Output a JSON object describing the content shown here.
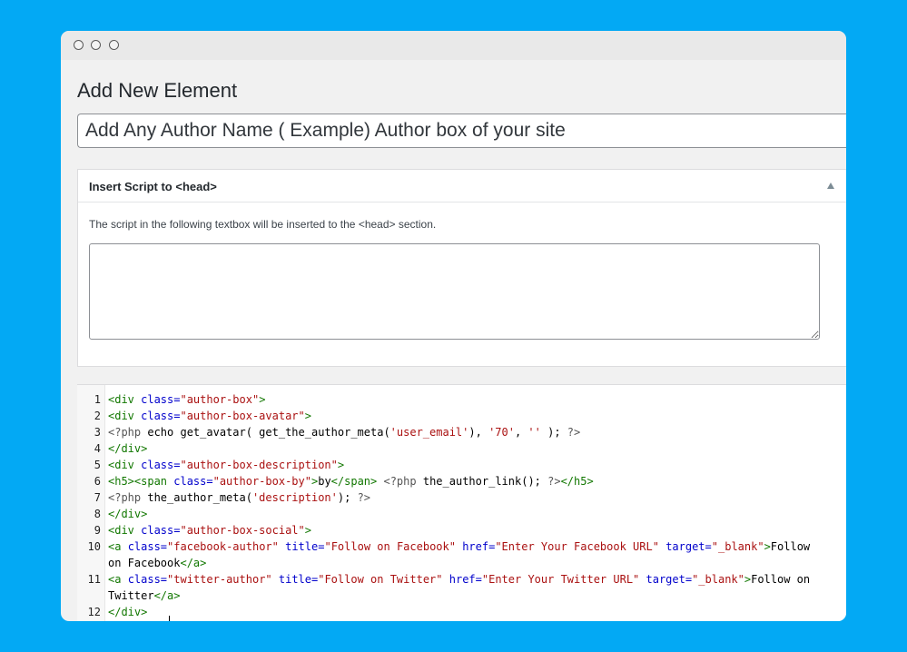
{
  "page": {
    "title": "Add New Element",
    "title_input_value": "Add Any Author Name ( Example) Author box of your site"
  },
  "colors": {
    "background": "#03a9f4",
    "window": "#f1f1f1",
    "titlebar": "#e9e9e9",
    "code_tag": "#117700",
    "code_attr": "#0000cc",
    "code_string": "#aa1111"
  },
  "window_controls": [
    "close-dot",
    "minimize-dot",
    "maximize-dot"
  ],
  "head_box": {
    "title": "Insert Script to <head>",
    "toggle_icon": "triangle-up-icon",
    "description": "The script in the following textbox will be inserted to the <head> section.",
    "textarea_value": ""
  },
  "code_editor": {
    "lines": [
      {
        "num": "1",
        "tokens": [
          {
            "t": "tag",
            "v": "<div "
          },
          {
            "t": "attr",
            "v": "class="
          },
          {
            "t": "str",
            "v": "\"author-box\""
          },
          {
            "t": "tag",
            "v": ">"
          }
        ]
      },
      {
        "num": "2",
        "tokens": [
          {
            "t": "tag",
            "v": "<div "
          },
          {
            "t": "attr",
            "v": "class="
          },
          {
            "t": "str",
            "v": "\"author-box-avatar\""
          },
          {
            "t": "tag",
            "v": ">"
          }
        ]
      },
      {
        "num": "3",
        "tokens": [
          {
            "t": "php",
            "v": "<?php "
          },
          {
            "t": "txt",
            "v": "echo get_avatar( get_the_author_meta("
          },
          {
            "t": "str",
            "v": "'user_email'"
          },
          {
            "t": "txt",
            "v": "), "
          },
          {
            "t": "str",
            "v": "'70'"
          },
          {
            "t": "txt",
            "v": ", "
          },
          {
            "t": "str",
            "v": "''"
          },
          {
            "t": "txt",
            "v": " ); "
          },
          {
            "t": "php",
            "v": "?>"
          }
        ]
      },
      {
        "num": "4",
        "tokens": [
          {
            "t": "tag",
            "v": "</div>"
          }
        ]
      },
      {
        "num": "5",
        "tokens": [
          {
            "t": "tag",
            "v": "<div "
          },
          {
            "t": "attr",
            "v": "class="
          },
          {
            "t": "str",
            "v": "\"author-box-description\""
          },
          {
            "t": "tag",
            "v": ">"
          }
        ]
      },
      {
        "num": "6",
        "tokens": [
          {
            "t": "tag",
            "v": "<h5><span "
          },
          {
            "t": "attr",
            "v": "class="
          },
          {
            "t": "str",
            "v": "\"author-box-by\""
          },
          {
            "t": "tag",
            "v": ">"
          },
          {
            "t": "txt",
            "v": "by"
          },
          {
            "t": "tag",
            "v": "</span>"
          },
          {
            "t": "txt",
            "v": " "
          },
          {
            "t": "php",
            "v": "<?php "
          },
          {
            "t": "txt",
            "v": "the_author_link(); "
          },
          {
            "t": "php",
            "v": "?>"
          },
          {
            "t": "tag",
            "v": "</h5>"
          }
        ]
      },
      {
        "num": "7",
        "tokens": [
          {
            "t": "php",
            "v": "<?php "
          },
          {
            "t": "txt",
            "v": "the_author_meta("
          },
          {
            "t": "str",
            "v": "'description'"
          },
          {
            "t": "txt",
            "v": "); "
          },
          {
            "t": "php",
            "v": "?>"
          }
        ]
      },
      {
        "num": "8",
        "tokens": [
          {
            "t": "tag",
            "v": "</div>"
          }
        ]
      },
      {
        "num": "9",
        "tokens": [
          {
            "t": "tag",
            "v": "<div "
          },
          {
            "t": "attr",
            "v": "class="
          },
          {
            "t": "str",
            "v": "\"author-box-social\""
          },
          {
            "t": "tag",
            "v": ">"
          }
        ]
      },
      {
        "num": "10",
        "tokens": [
          {
            "t": "tag",
            "v": "<a "
          },
          {
            "t": "attr",
            "v": "class="
          },
          {
            "t": "str",
            "v": "\"facebook-author\""
          },
          {
            "t": "txt",
            "v": " "
          },
          {
            "t": "attr",
            "v": "title="
          },
          {
            "t": "str",
            "v": "\"Follow on Facebook\""
          },
          {
            "t": "txt",
            "v": " "
          },
          {
            "t": "attr",
            "v": "href="
          },
          {
            "t": "str",
            "v": "\"Enter Your Facebook URL\""
          },
          {
            "t": "txt",
            "v": " "
          },
          {
            "t": "attr",
            "v": "target="
          },
          {
            "t": "str",
            "v": "\"_blank\""
          },
          {
            "t": "tag",
            "v": ">"
          },
          {
            "t": "txt",
            "v": "Follow on Facebook"
          },
          {
            "t": "tag",
            "v": "</a>"
          }
        ]
      },
      {
        "num": "11",
        "tokens": [
          {
            "t": "tag",
            "v": "<a "
          },
          {
            "t": "attr",
            "v": "class="
          },
          {
            "t": "str",
            "v": "\"twitter-author\""
          },
          {
            "t": "txt",
            "v": " "
          },
          {
            "t": "attr",
            "v": "title="
          },
          {
            "t": "str",
            "v": "\"Follow on Twitter\""
          },
          {
            "t": "txt",
            "v": " "
          },
          {
            "t": "attr",
            "v": "href="
          },
          {
            "t": "str",
            "v": "\"Enter Your Twitter URL\""
          },
          {
            "t": "txt",
            "v": " "
          },
          {
            "t": "attr",
            "v": "target="
          },
          {
            "t": "str",
            "v": "\"_blank\""
          },
          {
            "t": "tag",
            "v": ">"
          },
          {
            "t": "txt",
            "v": "Follow on Twitter"
          },
          {
            "t": "tag",
            "v": "</a>"
          }
        ]
      },
      {
        "num": "12",
        "tokens": [
          {
            "t": "tag",
            "v": "</div>"
          }
        ]
      }
    ]
  }
}
